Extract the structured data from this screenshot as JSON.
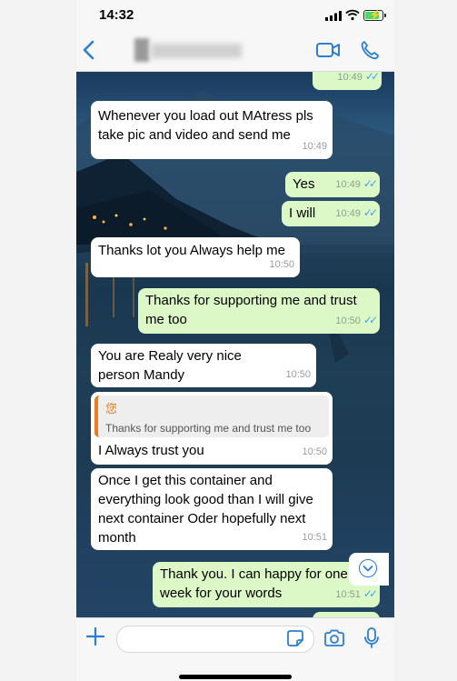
{
  "status_bar": {
    "time": "14:32"
  },
  "nav": {
    "back_icon": "chevron-left-icon",
    "video_icon": "video-camera-icon",
    "call_icon": "phone-icon"
  },
  "messages": [
    {
      "dir": "out",
      "text": "",
      "time": "10:49",
      "status": "read"
    },
    {
      "dir": "in",
      "text": "Whenever you load out MAtress pls take pic and video and send me",
      "time": "10:49"
    },
    {
      "dir": "out",
      "text": "Yes",
      "time": "10:49",
      "status": "read"
    },
    {
      "dir": "out",
      "text": "I will",
      "time": "10:49",
      "status": "read"
    },
    {
      "dir": "in",
      "text": "Thanks lot you Always help me",
      "time": "10:50"
    },
    {
      "dir": "out",
      "text": "Thanks for supporting me and trust me too",
      "time": "10:50",
      "status": "read"
    },
    {
      "dir": "in",
      "text": "You are Realy very nice person Mandy",
      "time": "10:50"
    },
    {
      "dir": "in",
      "text": "I Always trust you",
      "time": "10:50",
      "reply_to": {
        "name": "您",
        "text": "Thanks for supporting me and trust me too"
      }
    },
    {
      "dir": "in",
      "text": "Once I get this container and everything look good than I will give next container Oder hopefully next month",
      "time": "10:51"
    },
    {
      "dir": "out",
      "text": "Thank you.  I can happy for one week for your words",
      "time": "10:51",
      "status": "read"
    }
  ],
  "input": {
    "placeholder": ""
  },
  "colors": {
    "accent": "#2d7dd2",
    "outgoing": "#dcf8c6",
    "incoming": "#ffffff",
    "read_ticks": "#4fa3e0",
    "reply_bar": "#e67e22"
  }
}
